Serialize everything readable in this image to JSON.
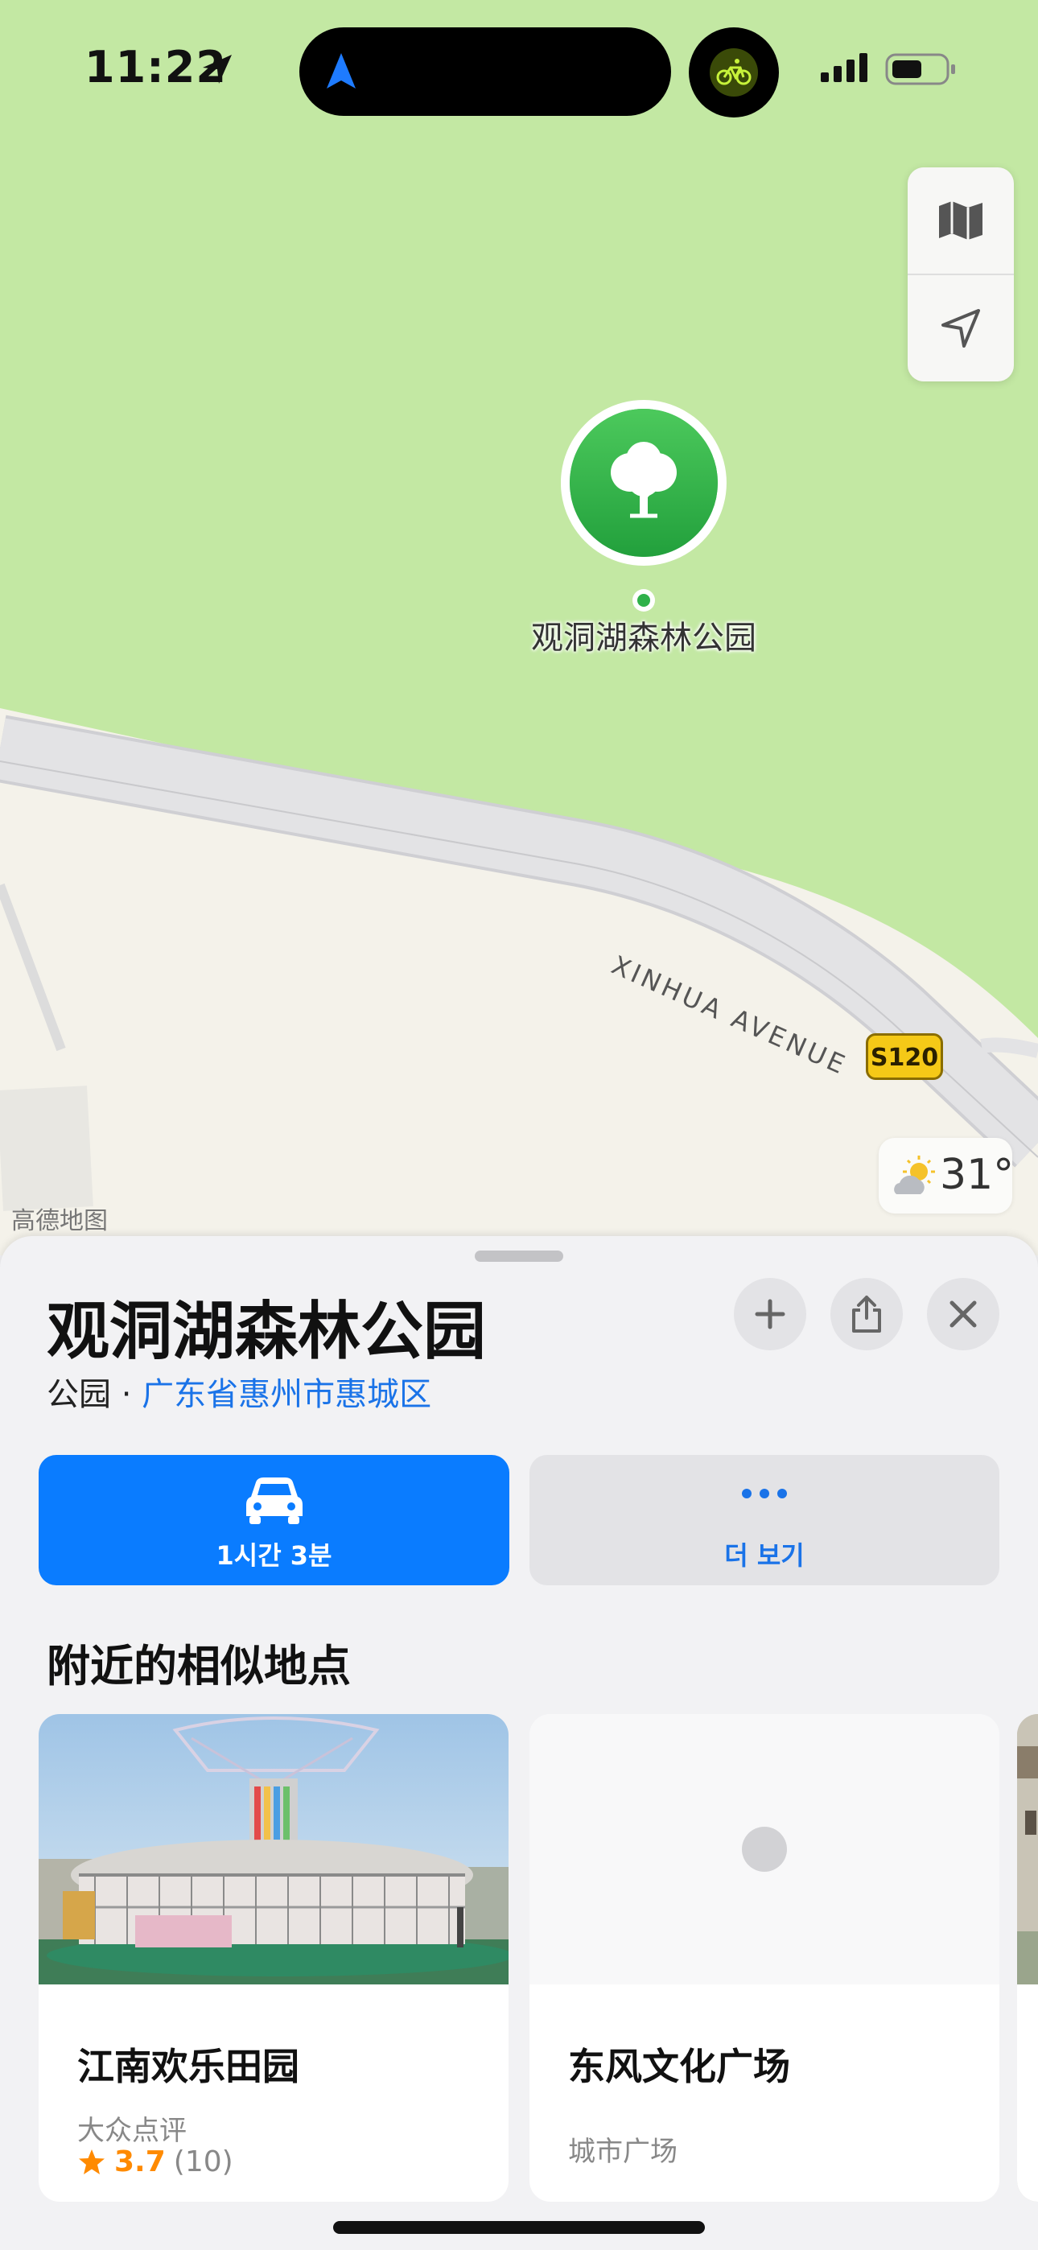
{
  "status_bar": {
    "time": "11:22"
  },
  "map": {
    "place_label": "观洞湖森林公园",
    "road_name": "XINHUA AVENUE",
    "route_shield": "S120",
    "weather_temp": "31°",
    "provider": "高德地图",
    "colors": {
      "park": "#c3e8a3",
      "land": "#f4f2ea",
      "road": "#e3e3e5",
      "pin": "#2fb14a"
    }
  },
  "sheet": {
    "title": "观洞湖森林公园",
    "category": "公园",
    "separator": " · ",
    "location_link": "广东省惠州市惠城区",
    "actions": {
      "directions_label": "1시간 3분",
      "more_label": "더 보기"
    },
    "section_title": "附近的相似地点",
    "cards": [
      {
        "name": "江南欢乐田园",
        "source": "大众点评",
        "rating": "3.7",
        "reviews": "(10)"
      },
      {
        "name": "东风文化广场",
        "category": "城市广场"
      }
    ]
  },
  "icons": {
    "location_arrow": "location-arrow-icon",
    "navigation": "navigation-icon",
    "bike": "bicycle-icon",
    "map_mode": "map-icon",
    "locate": "locate-icon",
    "tree": "tree-icon",
    "weather": "partly-cloudy-icon",
    "add": "plus-icon",
    "share": "share-icon",
    "close": "close-icon",
    "car": "car-icon",
    "more": "ellipsis-icon",
    "star": "star-icon"
  }
}
